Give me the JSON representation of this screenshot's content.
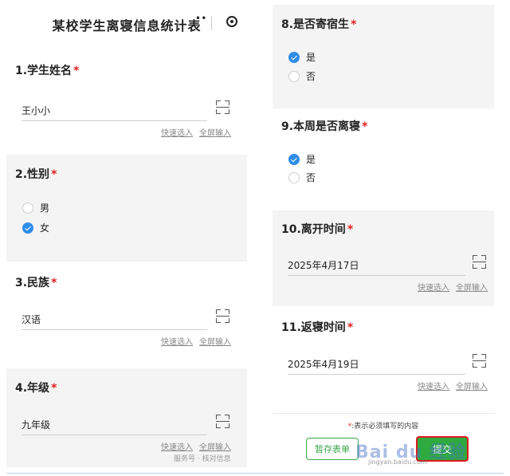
{
  "form_title": "某校学生离寝信息统计表",
  "title_dots": "••",
  "links": {
    "quick": "快速选入",
    "full": "全屏输入"
  },
  "required_mark": "*",
  "left_questions": {
    "q1": {
      "title": "1.学生姓名",
      "value": "王小小"
    },
    "q2": {
      "title": "2.性别",
      "options": [
        "男",
        "女"
      ],
      "selected": "女"
    },
    "q3": {
      "title": "3.民族",
      "value": "汉语"
    },
    "q4": {
      "title": "4.年级",
      "value": "九年级"
    }
  },
  "watermark_left": "服务号 · 核对信息",
  "right_questions": {
    "q8": {
      "title": "8.是否寄宿生",
      "options": [
        "是",
        "否"
      ],
      "selected": "是"
    },
    "q9": {
      "title": "9.本周是否离寝",
      "options": [
        "是",
        "否"
      ],
      "selected": "是"
    },
    "q10": {
      "title": "10.离开时间",
      "value": "2025年4月17日"
    },
    "q11": {
      "title": "11.返寝时间",
      "value": "2025年4月19日"
    }
  },
  "footer": {
    "required_prefix": "*",
    "required_note": ":表示必须填写的内容",
    "save_label": "暂存表单",
    "submit_label": "提交"
  },
  "watermark_right": "Bai du 经验",
  "watermark_right_sub": "jingyan.baidu.com",
  "colors": {
    "accent_blue": "#2f8ce8",
    "submit_green": "#2eaa3e",
    "required_red": "#e02020"
  }
}
